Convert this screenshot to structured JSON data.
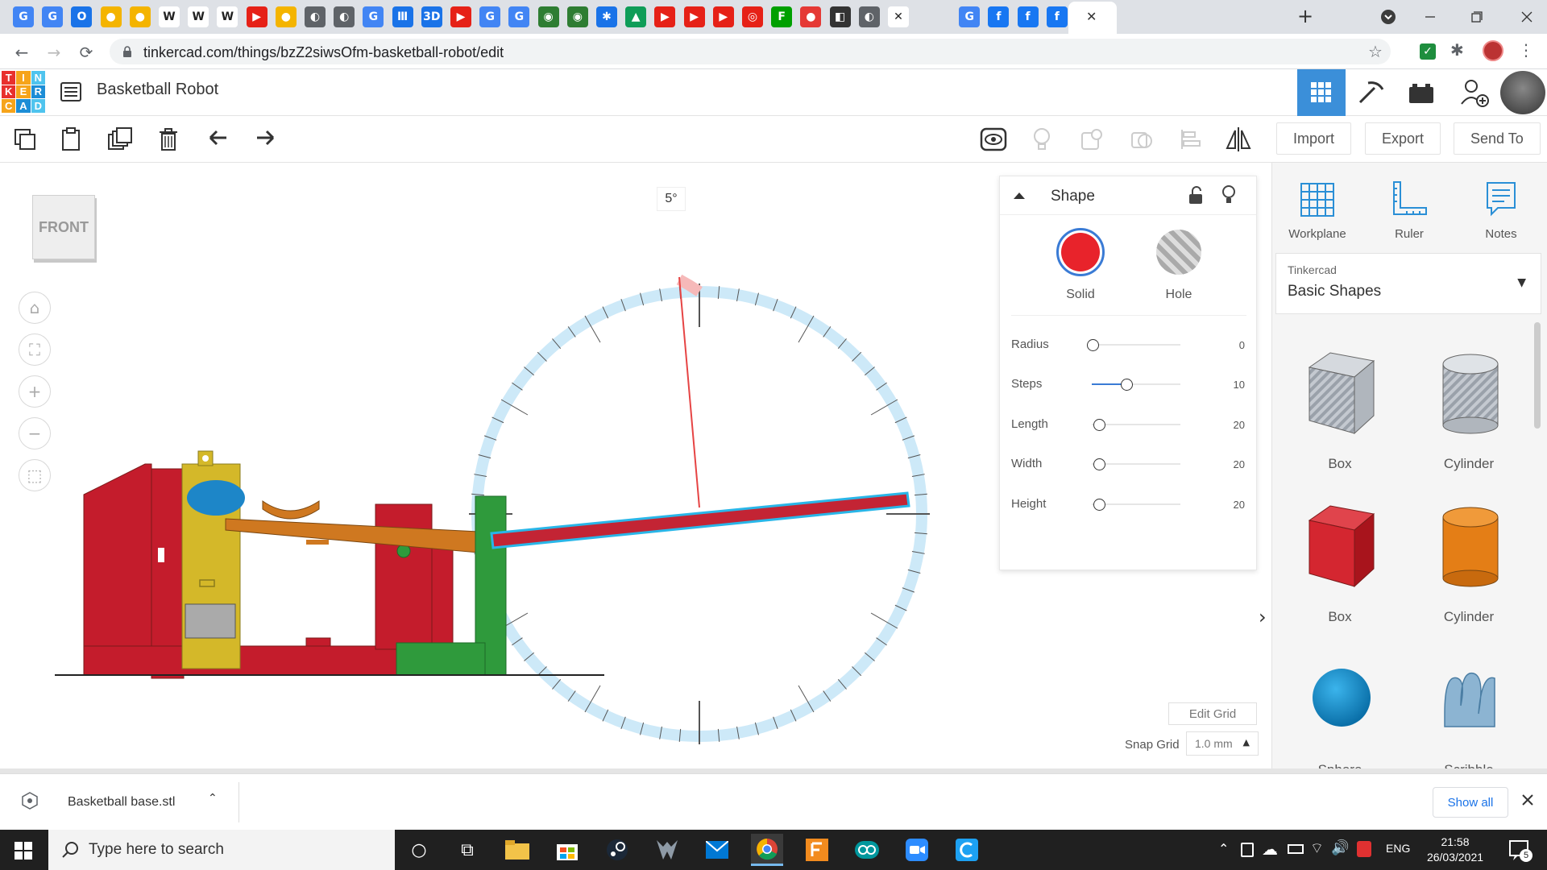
{
  "browser": {
    "url": "tinkercad.com/things/bzZ2siwsOfm-basketball-robot/edit",
    "new_tab_glyph": "+",
    "close_tab_glyph": "✕",
    "favicon_colors": [
      "#4285f4",
      "#4285f4",
      "#1a73e8",
      "#f4b400",
      "#f4b400",
      "#ffffff",
      "#ffffff",
      "#ffffff",
      "#e62117",
      "#f4b400",
      "#5f6368",
      "#5f6368",
      "#4285f4",
      "#1a73e8",
      "#1a73e8",
      "#e62117",
      "#4285f4",
      "#4285f4",
      "#2e7d32",
      "#2e7d32",
      "#1a73e8",
      "#0f9d58",
      "#e62117",
      "#e62117",
      "#e62117",
      "#e62117",
      "#00a000",
      "#e53935",
      "#333333",
      "#5f6368",
      "#ffffff",
      "#4285f4",
      "#1877f2",
      "#1877f2",
      "#1877f2",
      "#111111"
    ],
    "favicon_glyphs": [
      "G",
      "G",
      "O",
      "●",
      "●",
      "W",
      "W",
      "W",
      "▶",
      "●",
      "◐",
      "◐",
      "G",
      "Ⅲ",
      "3D",
      "▶",
      "G",
      "G",
      "◉",
      "◉",
      "✱",
      "▲",
      "▶",
      "▶",
      "▶",
      "◎",
      "F",
      "●",
      "◧",
      "◐",
      "✕",
      "G",
      "f",
      "f",
      "f",
      "F"
    ]
  },
  "tinkercad": {
    "logo_letters": [
      "T",
      "I",
      "N",
      "K",
      "E",
      "R",
      "C",
      "A",
      "D"
    ],
    "logo_colors": [
      "#e8302d",
      "#f6a41a",
      "#4fc4ee",
      "#e8302d",
      "#f6a41a",
      "#1c8dd6",
      "#f6a41a",
      "#1c8dd6",
      "#4fc4ee"
    ],
    "project_title": "Basketball Robot",
    "toolbar": {
      "import": "Import",
      "export": "Export",
      "send_to": "Send To"
    }
  },
  "workspace": {
    "view_label": "FRONT",
    "angle_readout": "5°"
  },
  "inspector": {
    "title": "Shape",
    "solid_label": "Solid",
    "hole_label": "Hole",
    "solid_color": "#e8232b",
    "properties": [
      {
        "label": "Radius",
        "value": "0"
      },
      {
        "label": "Steps",
        "value": "10"
      },
      {
        "label": "Length",
        "value": "20"
      },
      {
        "label": "Width",
        "value": "20"
      },
      {
        "label": "Height",
        "value": "20"
      }
    ],
    "edit_grid": "Edit Grid",
    "snap_grid_label": "Snap Grid",
    "snap_grid_value": "1.0 mm"
  },
  "library": {
    "tools": [
      {
        "label": "Workplane",
        "icon": "workplane-icon"
      },
      {
        "label": "Ruler",
        "icon": "ruler-icon"
      },
      {
        "label": "Notes",
        "icon": "notes-icon"
      }
    ],
    "category_small": "Tinkercad",
    "category": "Basic Shapes",
    "shapes": [
      {
        "label": "Box",
        "kind": "box-hole"
      },
      {
        "label": "Cylinder",
        "kind": "cylinder-hole"
      },
      {
        "label": "Box",
        "kind": "box-red"
      },
      {
        "label": "Cylinder",
        "kind": "cylinder-orange"
      },
      {
        "label": "Sphere",
        "kind": "sphere-blue"
      },
      {
        "label": "Scribble",
        "kind": "scribble"
      }
    ]
  },
  "downloads": {
    "file_name": "Basketball base.stl",
    "show_all": "Show all"
  },
  "taskbar": {
    "search_placeholder": "Type here to search",
    "language": "ENG",
    "time": "21:58",
    "date": "26/03/2021",
    "notification_count": "5"
  }
}
